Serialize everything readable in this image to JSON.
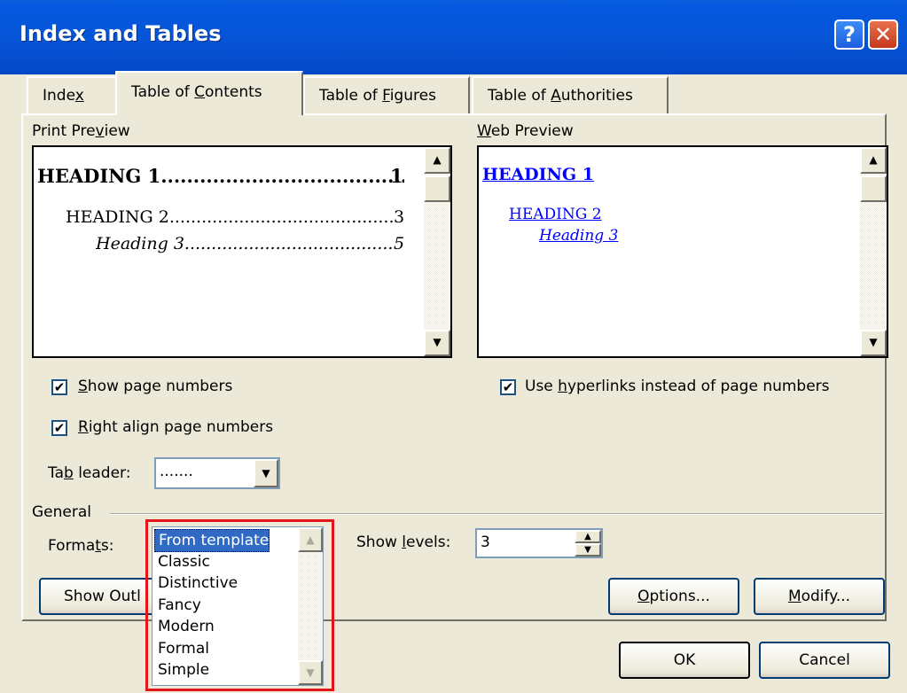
{
  "window": {
    "title": "Index and Tables",
    "help_label": "?",
    "close_label": "✕"
  },
  "tabs": [
    {
      "label_pre": "Inde",
      "label_u": "x",
      "label_post": ""
    },
    {
      "label_pre": "Table of ",
      "label_u": "C",
      "label_post": "ontents",
      "active": true
    },
    {
      "label_pre": "Table of ",
      "label_u": "F",
      "label_post": "igures"
    },
    {
      "label_pre": "Table of ",
      "label_u": "A",
      "label_post": "uthorities"
    }
  ],
  "print_preview": {
    "label_pre": "Print Pre",
    "label_u": "v",
    "label_post": "iew",
    "h1": {
      "text": "HEADING 1",
      "leader": "......................................",
      "page": "1"
    },
    "h2": {
      "text": "HEADING 2",
      "leader": "................................................",
      "page": "3"
    },
    "h3": {
      "text": "Heading 3",
      "leader": "...................................................",
      "page": "5"
    }
  },
  "web_preview": {
    "label_u": "W",
    "label_post": "eb Preview",
    "h1": "HEADING 1",
    "h2": "HEADING 2",
    "h3": "Heading 3"
  },
  "options": {
    "show_page_numbers": {
      "u": "S",
      "rest": "how page numbers",
      "checked": true
    },
    "right_align": {
      "u": "R",
      "rest": "ight align page numbers",
      "checked": true
    },
    "use_hyperlinks": {
      "pre": "Use ",
      "u": "h",
      "rest": "yperlinks instead of page numbers",
      "checked": true
    },
    "check_glyph": "✔"
  },
  "tab_leader": {
    "pre": "Ta",
    "u": "b",
    "post": " leader:",
    "value": "......."
  },
  "general": {
    "label": "General",
    "formats_pre": "Forma",
    "formats_u": "t",
    "formats_post": "s:",
    "format_options": [
      "From template",
      "Classic",
      "Distinctive",
      "Fancy",
      "Modern",
      "Formal",
      "Simple"
    ],
    "selected_format": "From template",
    "show_levels_pre": "Show ",
    "show_levels_u": "l",
    "show_levels_post": "evels:",
    "show_levels_value": "3"
  },
  "buttons": {
    "show_outlining": "Show Outl",
    "options_u": "O",
    "options_rest": "ptions...",
    "modify_u": "M",
    "modify_rest": "odify...",
    "ok": "OK",
    "cancel": "Cancel"
  },
  "colors": {
    "link": "#0000ff",
    "selection": "#316ac5",
    "highlight_box": "#e4141b",
    "title_bar": "#0558e0"
  }
}
